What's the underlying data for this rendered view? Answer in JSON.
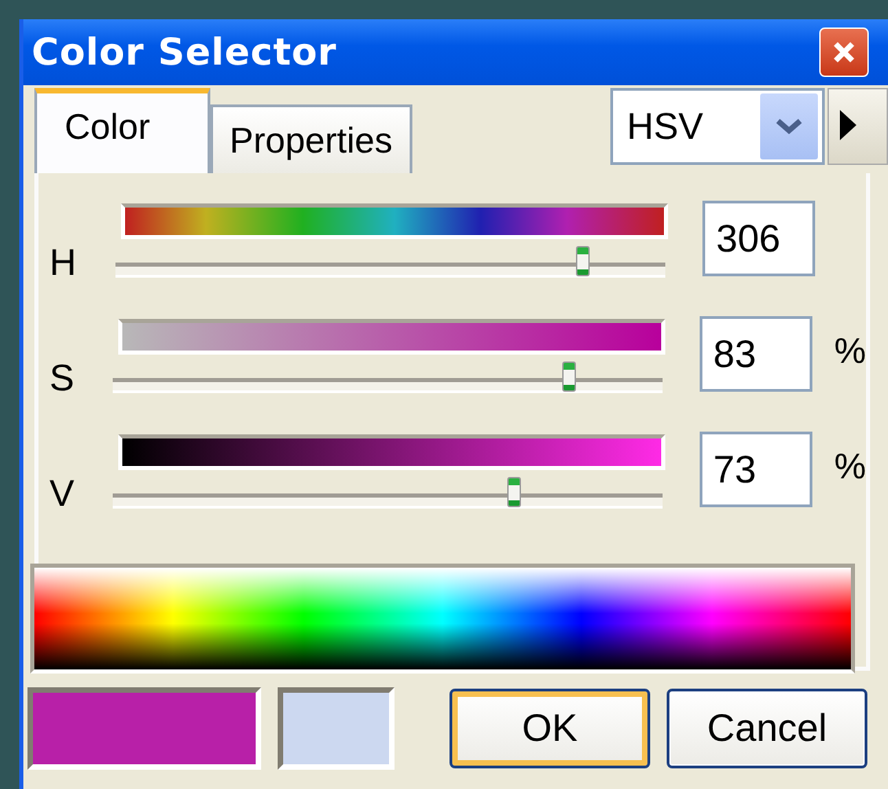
{
  "window": {
    "title": "Color Selector"
  },
  "tabs": [
    {
      "label": "Color",
      "selected": true
    },
    {
      "label": "Properties",
      "selected": false
    }
  ],
  "mode_dropdown": {
    "value": "HSV"
  },
  "channels": [
    {
      "label": "H",
      "kind": "hue",
      "value": "306",
      "level": 0.85
    },
    {
      "label": "S",
      "kind": "saturation",
      "value": "83",
      "unit": "%",
      "level": 0.83
    },
    {
      "label": "V",
      "kind": "value",
      "value": "73",
      "unit": "%",
      "level": 0.73
    }
  ],
  "swatches": [
    {
      "color": "#b820a8"
    },
    {
      "color": "#ccd8f0"
    }
  ],
  "buttons": [
    {
      "label": "OK",
      "default": true
    },
    {
      "label": "Cancel",
      "default": false
    }
  ]
}
